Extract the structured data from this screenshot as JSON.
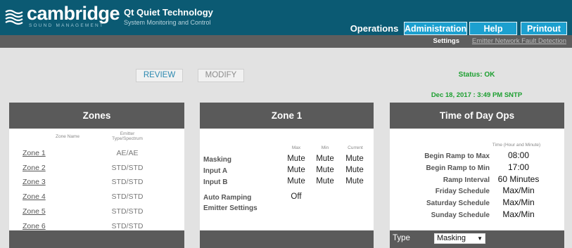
{
  "header": {
    "brand": "cambridge",
    "brand_sub": "SOUND MANAGEMENT",
    "product": "Qt Quiet Technology",
    "product_sub": "System Monitoring and Control",
    "accent_color": "#0b5a73",
    "tab_color": "#1ca0cf"
  },
  "nav": {
    "operations": "Operations",
    "administration": "Administration",
    "help": "Help",
    "printout": "Printout"
  },
  "subnav": {
    "settings": "Settings",
    "emitter": "Emitter Network Fault Detection"
  },
  "toolbar": {
    "review": "REVIEW",
    "modify": "MODIFY"
  },
  "status": {
    "text": "Status: OK",
    "datetime": "Dec 18, 2017 : 3:49 PM SNTP",
    "color": "#1c9f30"
  },
  "zones": {
    "title": "Zones",
    "col_name": "Zone Name",
    "col_type_1": "Emitter",
    "col_type_2": "Type/Spectrum",
    "rows": [
      {
        "name": "Zone 1",
        "type": "AE/AE"
      },
      {
        "name": "Zone 2",
        "type": "STD/STD"
      },
      {
        "name": "Zone 3",
        "type": "STD/STD"
      },
      {
        "name": "Zone 4",
        "type": "STD/STD"
      },
      {
        "name": "Zone 5",
        "type": "STD/STD"
      },
      {
        "name": "Zone 6",
        "type": "STD/STD"
      }
    ]
  },
  "zone1": {
    "title": "Zone 1",
    "col_max": "Max",
    "col_min": "Min",
    "col_current": "Current",
    "rows": [
      {
        "label": "Masking",
        "max": "Mute",
        "min": "Mute",
        "current": "Mute"
      },
      {
        "label": "Input A",
        "max": "Mute",
        "min": "Mute",
        "current": "Mute"
      },
      {
        "label": "Input B",
        "max": "Mute",
        "min": "Mute",
        "current": "Mute"
      }
    ],
    "auto_ramping_label": "Auto Ramping",
    "auto_ramping_value": "Off",
    "emitter_settings_label": "Emitter Settings"
  },
  "tod": {
    "title": "Time of Day Ops",
    "col_time": "Time (Hour and Minute)",
    "rows": [
      {
        "label": "Begin Ramp to Max",
        "value": "08:00"
      },
      {
        "label": "Begin Ramp to Min",
        "value": "17:00"
      },
      {
        "label": "Ramp Interval",
        "value": "60 Minutes"
      },
      {
        "label": "Friday Schedule",
        "value": "Max/Min"
      },
      {
        "label": "Saturday Schedule",
        "value": "Max/Min"
      },
      {
        "label": "Sunday Schedule",
        "value": "Max/Min"
      }
    ],
    "type_label": "Type",
    "type_value": "Masking"
  }
}
